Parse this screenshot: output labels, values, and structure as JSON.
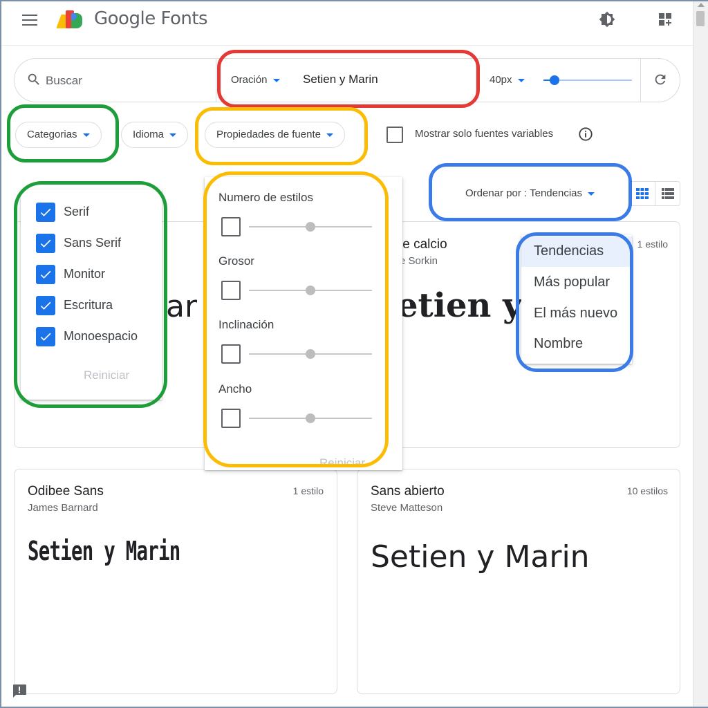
{
  "header": {
    "brand": "Google Fonts",
    "menu_icon": "menu-icon",
    "theme_icon": "brightness-icon",
    "collection_icon": "grid-add-icon"
  },
  "toolbar": {
    "search_placeholder": "Buscar",
    "preview_type": "Oración",
    "preview_text": "Setien y Marin",
    "font_size": "40px",
    "font_size_slider_fraction": 0.07,
    "refresh_icon": "refresh-icon"
  },
  "filters": {
    "categories": "Categorias",
    "language": "Idioma",
    "font_properties": "Propiedades de fuente",
    "variable_only": "Mostrar solo fuentes variables",
    "variable_only_checked": false
  },
  "categories_menu": {
    "items": [
      {
        "label": "Serif",
        "checked": true
      },
      {
        "label": "Sans Serif",
        "checked": true
      },
      {
        "label": "Monitor",
        "checked": true
      },
      {
        "label": "Escritura",
        "checked": true
      },
      {
        "label": "Monoespacio",
        "checked": true
      }
    ],
    "reset": "Reiniciar"
  },
  "properties_menu": {
    "items": [
      {
        "label": "Numero de estilos",
        "checked": false,
        "slider_fraction": 0.5
      },
      {
        "label": "Grosor",
        "checked": false,
        "slider_fraction": 0.5
      },
      {
        "label": "Inclinación",
        "checked": false,
        "slider_fraction": 0.5
      },
      {
        "label": "Ancho",
        "checked": false,
        "slider_fraction": 0.5
      }
    ],
    "reset": "Reiniciar"
  },
  "sort": {
    "label": "Ordenar por : Tendencias",
    "options": [
      {
        "label": "Tendencias",
        "selected": true
      },
      {
        "label": "Más popular",
        "selected": false
      },
      {
        "label": "El más nuevo",
        "selected": false
      },
      {
        "label": "Nombre",
        "selected": false
      }
    ]
  },
  "cards": [
    {
      "title": "le calcio",
      "author": "e Sorkin",
      "styles": "1 estilo",
      "preview_partial": "etien y A",
      "preview_partial_left": "ar"
    },
    {
      "title": "Odibee Sans",
      "author": "James Barnard",
      "styles": "1 estilo",
      "preview": "Setien y Marin"
    },
    {
      "title": "Sans abierto",
      "author": "Steve Matteson",
      "styles": "10 estilos",
      "preview": "Setien y Marin"
    }
  ],
  "colors": {
    "accent": "#1a73e8",
    "annotation_red": "#e53935",
    "annotation_green": "#1e9e3a",
    "annotation_yellow": "#fbbc05",
    "annotation_blue": "#3b7be8"
  }
}
